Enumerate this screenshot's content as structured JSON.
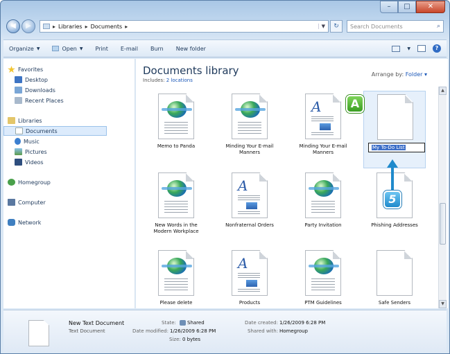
{
  "address": {
    "crumbs": [
      "Libraries",
      "Documents"
    ]
  },
  "search": {
    "placeholder": "Search Documents"
  },
  "toolbar": {
    "organize": "Organize",
    "open": "Open",
    "print": "Print",
    "email": "E-mail",
    "burn": "Burn",
    "new_folder": "New folder"
  },
  "nav": {
    "favorites": "Favorites",
    "desktop": "Desktop",
    "downloads": "Downloads",
    "recent": "Recent Places",
    "libraries": "Libraries",
    "documents": "Documents",
    "music": "Music",
    "pictures": "Pictures",
    "videos": "Videos",
    "homegroup": "Homegroup",
    "computer": "Computer",
    "network": "Network"
  },
  "library": {
    "title": "Documents library",
    "includes": "Includes:",
    "locations": "2 locations",
    "arrange_label": "Arrange by:",
    "arrange_value": "Folder"
  },
  "files": [
    {
      "name": "Memo to Panda",
      "type": "web"
    },
    {
      "name": "Minding Your E-mail Manners",
      "type": "web"
    },
    {
      "name": "Minding Your E-mail Manners",
      "type": "word"
    },
    {
      "name": "My To-Do List",
      "type": "text",
      "renaming": true
    },
    {
      "name": "New Words in the Modern Workplace",
      "type": "web"
    },
    {
      "name": "Nonfraternal Orders",
      "type": "word"
    },
    {
      "name": "Party Invitation",
      "type": "web"
    },
    {
      "name": "Phishing Addresses",
      "type": "text"
    },
    {
      "name": "Please delete",
      "type": "web"
    },
    {
      "name": "Products",
      "type": "word"
    },
    {
      "name": "PTM Guidelines",
      "type": "web"
    },
    {
      "name": "Safe Senders",
      "type": "text"
    }
  ],
  "callouts": {
    "a": "A",
    "step": "5"
  },
  "details": {
    "name": "New Text Document",
    "type": "Text Document",
    "state_label": "State:",
    "state_value": "Shared",
    "modified_label": "Date modified:",
    "modified_value": "1/26/2009 6:28 PM",
    "size_label": "Size:",
    "size_value": "0 bytes",
    "created_label": "Date created:",
    "created_value": "1/26/2009 6:28 PM",
    "shared_label": "Shared with:",
    "shared_value": "Homegroup"
  }
}
